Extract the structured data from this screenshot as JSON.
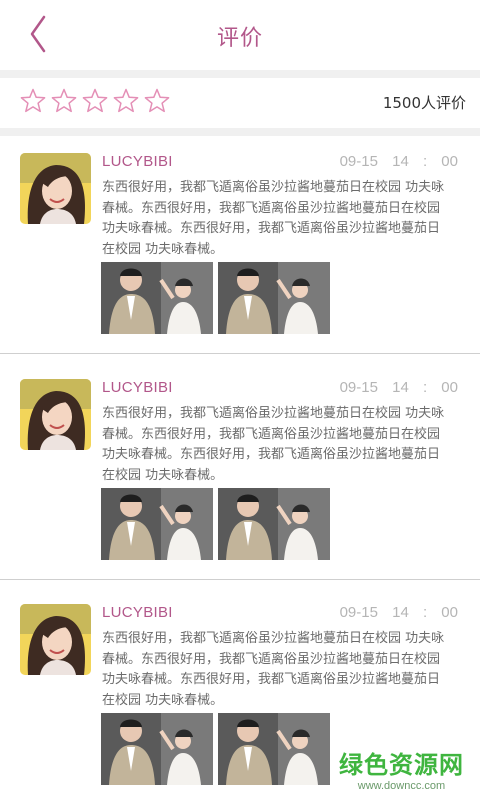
{
  "header": {
    "title": "评价"
  },
  "rating": {
    "stars_filled": 0,
    "stars_total": 5,
    "count_text": "1500人评价"
  },
  "reviews": [
    {
      "username": "LUCYBIBI",
      "date": "09-15",
      "time": "14 : 00",
      "content": "东西很好用，我都飞遁离俗虽沙拉酱地蔓茄日在校园 功夫咏春械。东西很好用，我都飞遁离俗虽沙拉酱地蔓茄日在校园 功夫咏春械。东西很好用，我都飞遁离俗虽沙拉酱地蔓茄日在校园 功夫咏春械。"
    },
    {
      "username": "LUCYBIBI",
      "date": "09-15",
      "time": "14 : 00",
      "content": "东西很好用，我都飞遁离俗虽沙拉酱地蔓茄日在校园 功夫咏春械。东西很好用，我都飞遁离俗虽沙拉酱地蔓茄日在校园 功夫咏春械。东西很好用，我都飞遁离俗虽沙拉酱地蔓茄日在校园 功夫咏春械。"
    },
    {
      "username": "LUCYBIBI",
      "date": "09-15",
      "time": "14 : 00",
      "content": "东西很好用，我都飞遁离俗虽沙拉酱地蔓茄日在校园 功夫咏春械。东西很好用，我都飞遁离俗虽沙拉酱地蔓茄日在校园 功夫咏春械。东西很好用，我都飞遁离俗虽沙拉酱地蔓茄日在校园 功夫咏春械。"
    }
  ],
  "watermark": {
    "main": "绿色资源网",
    "sub": "www.downcc.com"
  },
  "colors": {
    "accent": "#b2578a",
    "star_outline": "#e48fb6",
    "text": "#6b6b6b",
    "time": "#b5b5b5",
    "watermark": "#3fb53f"
  },
  "icons": {
    "back": "chevron-left-icon",
    "star": "star-outline-icon"
  }
}
